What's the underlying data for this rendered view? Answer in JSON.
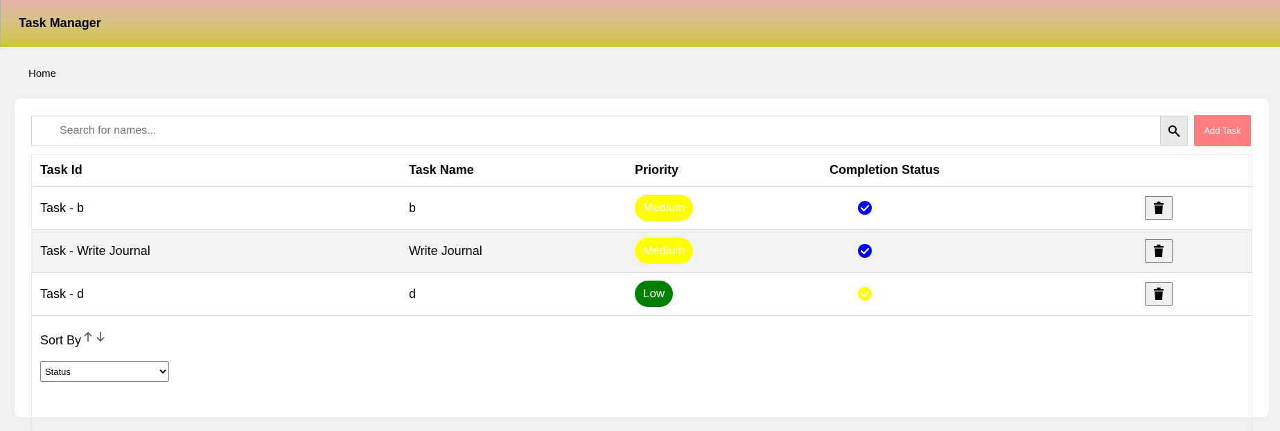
{
  "app": {
    "title": "Task Manager"
  },
  "breadcrumb": {
    "home": "Home"
  },
  "search": {
    "placeholder": "Search for names..."
  },
  "toolbar": {
    "add_label": "Add Task"
  },
  "table": {
    "headers": {
      "id": "Task Id",
      "name": "Task Name",
      "priority": "Priority",
      "status": "Completion Status"
    },
    "rows": [
      {
        "id": "Task - b",
        "name": "b",
        "priority": "Medium",
        "priority_color": "#ffff00",
        "status_color": "#0000ee",
        "status_icon": "check-circle-icon"
      },
      {
        "id": "Task - Write Journal",
        "name": "Write Journal",
        "priority": "Medium",
        "priority_color": "#ffff00",
        "status_color": "#0000ee",
        "status_icon": "check-circle-icon"
      },
      {
        "id": "Task - d",
        "name": "d",
        "priority": "Low",
        "priority_color": "#008000",
        "status_color": "#ffff00",
        "status_icon": "check-circle-icon"
      }
    ]
  },
  "sort": {
    "label": "Sort By",
    "selected": "Status",
    "asc_icon": "arrow-up-icon",
    "desc_icon": "arrow-down-icon"
  },
  "colors": {
    "add_button": "#ff7f7f",
    "header_gradient_top": "#e2b1a7",
    "header_gradient_bottom": "#cdc63a"
  }
}
